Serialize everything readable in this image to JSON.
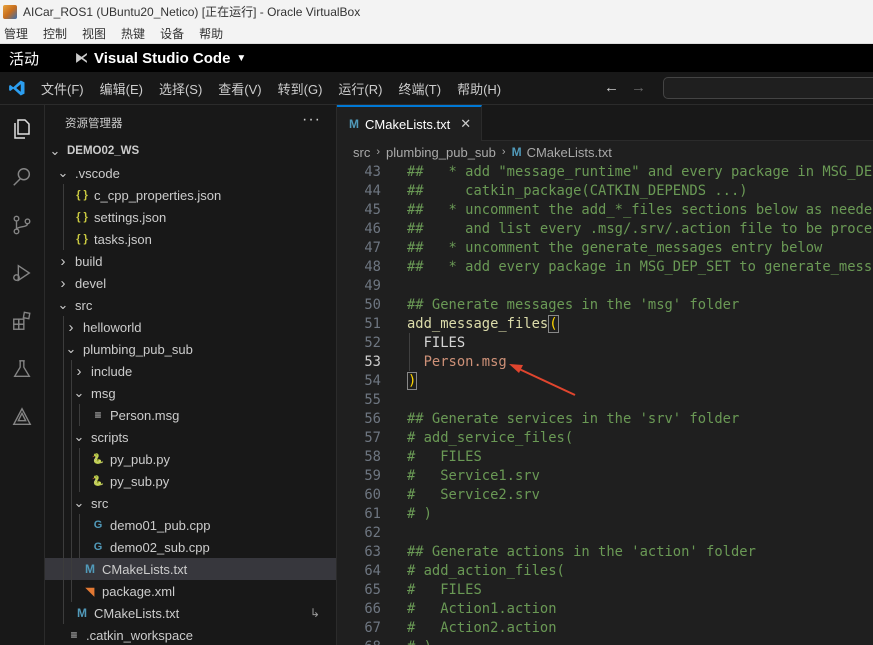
{
  "vbox": {
    "title": "AICar_ROS1 (UBuntu20_Netico) [正在运行] - Oracle VirtualBox",
    "menu": [
      "管理",
      "控制",
      "视图",
      "热键",
      "设备",
      "帮助"
    ]
  },
  "ubuntu": {
    "activities": "活动",
    "app_name": "Visual Studio Code"
  },
  "vscode": {
    "menu": [
      "文件(F)",
      "编辑(E)",
      "选择(S)",
      "查看(V)",
      "转到(G)",
      "运行(R)",
      "终端(T)",
      "帮助(H)"
    ],
    "activity_icons": [
      "explorer-icon",
      "search-icon",
      "source-control-icon",
      "run-debug-icon",
      "extensions-icon",
      "testing-icon",
      "ros-icon"
    ],
    "sidebar": {
      "title": "资源管理器",
      "tree": [
        {
          "label": "DEMO02_WS",
          "depth": 0,
          "type": "folder-open",
          "bold": true
        },
        {
          "label": ".vscode",
          "depth": 1,
          "type": "folder-open"
        },
        {
          "label": "c_cpp_properties.json",
          "depth": 2,
          "type": "json"
        },
        {
          "label": "settings.json",
          "depth": 2,
          "type": "json"
        },
        {
          "label": "tasks.json",
          "depth": 2,
          "type": "json"
        },
        {
          "label": "build",
          "depth": 1,
          "type": "folder"
        },
        {
          "label": "devel",
          "depth": 1,
          "type": "folder"
        },
        {
          "label": "src",
          "depth": 1,
          "type": "folder-open"
        },
        {
          "label": "helloworld",
          "depth": 2,
          "type": "folder"
        },
        {
          "label": "plumbing_pub_sub",
          "depth": 2,
          "type": "folder-open"
        },
        {
          "label": "include",
          "depth": 3,
          "type": "folder"
        },
        {
          "label": "msg",
          "depth": 3,
          "type": "folder-open"
        },
        {
          "label": "Person.msg",
          "depth": 4,
          "type": "txt"
        },
        {
          "label": "scripts",
          "depth": 3,
          "type": "folder-open"
        },
        {
          "label": "py_pub.py",
          "depth": 4,
          "type": "py"
        },
        {
          "label": "py_sub.py",
          "depth": 4,
          "type": "py"
        },
        {
          "label": "src",
          "depth": 3,
          "type": "folder-open"
        },
        {
          "label": "demo01_pub.cpp",
          "depth": 4,
          "type": "cpp"
        },
        {
          "label": "demo02_sub.cpp",
          "depth": 4,
          "type": "cpp"
        },
        {
          "label": "CMakeLists.txt",
          "depth": 3,
          "type": "cmake",
          "selected": true
        },
        {
          "label": "package.xml",
          "depth": 3,
          "type": "xml"
        },
        {
          "label": "CMakeLists.txt",
          "depth": 2,
          "type": "cmake",
          "badge": "↳"
        },
        {
          "label": ".catkin_workspace",
          "depth": 1,
          "type": "txt"
        }
      ]
    },
    "editor": {
      "tab_label": "CMakeLists.txt",
      "breadcrumb": [
        "src",
        "plumbing_pub_sub",
        "CMakeLists.txt"
      ],
      "current_line": 53,
      "lines": [
        {
          "n": 43,
          "text": "##   * add \"message_runtime\" and every package in MSG_DEP_SET to",
          "kind": "comment"
        },
        {
          "n": 44,
          "text": "##     catkin_package(CATKIN_DEPENDS ...)",
          "kind": "comment"
        },
        {
          "n": 45,
          "text": "##   * uncomment the add_*_files sections below as needed",
          "kind": "comment"
        },
        {
          "n": 46,
          "text": "##     and list every .msg/.srv/.action file to be processed",
          "kind": "comment"
        },
        {
          "n": 47,
          "text": "##   * uncomment the generate_messages entry below",
          "kind": "comment"
        },
        {
          "n": 48,
          "text": "##   * add every package in MSG_DEP_SET to generate_messages(DEPENDENCIES ...)",
          "kind": "comment"
        },
        {
          "n": 49,
          "text": "",
          "kind": "blank"
        },
        {
          "n": 50,
          "text": "## Generate messages in the 'msg' folder",
          "kind": "comment"
        },
        {
          "n": 51,
          "text": "add_message_files(",
          "kind": "func-open"
        },
        {
          "n": 52,
          "text": "  FILES",
          "kind": "keyword"
        },
        {
          "n": 53,
          "text": "  Person.msg",
          "kind": "string"
        },
        {
          "n": 54,
          "text": ")",
          "kind": "paren-close"
        },
        {
          "n": 55,
          "text": "",
          "kind": "blank"
        },
        {
          "n": 56,
          "text": "## Generate services in the 'srv' folder",
          "kind": "comment"
        },
        {
          "n": 57,
          "text": "# add_service_files(",
          "kind": "comment"
        },
        {
          "n": 58,
          "text": "#   FILES",
          "kind": "comment"
        },
        {
          "n": 59,
          "text": "#   Service1.srv",
          "kind": "comment"
        },
        {
          "n": 60,
          "text": "#   Service2.srv",
          "kind": "comment"
        },
        {
          "n": 61,
          "text": "# )",
          "kind": "comment"
        },
        {
          "n": 62,
          "text": "",
          "kind": "blank"
        },
        {
          "n": 63,
          "text": "## Generate actions in the 'action' folder",
          "kind": "comment"
        },
        {
          "n": 64,
          "text": "# add_action_files(",
          "kind": "comment"
        },
        {
          "n": 65,
          "text": "#   FILES",
          "kind": "comment"
        },
        {
          "n": 66,
          "text": "#   Action1.action",
          "kind": "comment"
        },
        {
          "n": 67,
          "text": "#   Action2.action",
          "kind": "comment"
        },
        {
          "n": 68,
          "text": "# )",
          "kind": "comment"
        }
      ]
    }
  },
  "colors": {
    "accent": "#0078d4",
    "annotation_arrow": "#e0452e",
    "comment": "#6a9955",
    "string": "#ce9178",
    "function": "#dcdcaa"
  }
}
